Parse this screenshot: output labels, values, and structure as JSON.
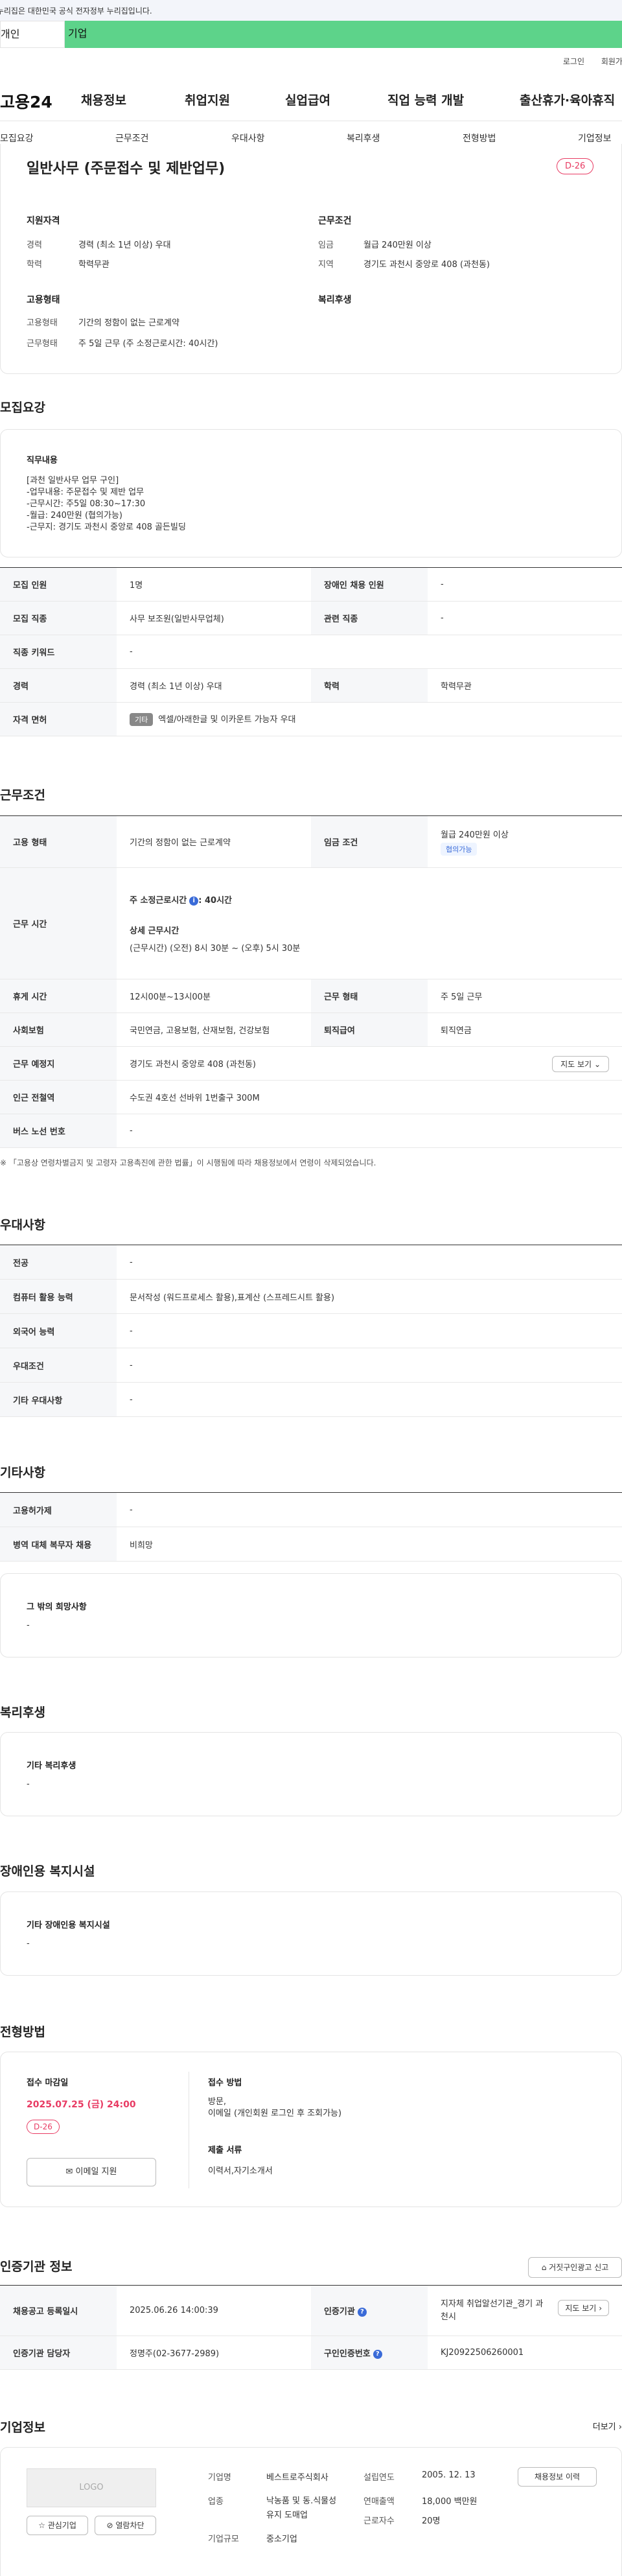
{
  "topbar": {
    "notice": "이 누리집은 대한민국 공식 전자정부 누리집입니다."
  },
  "greenbar": {
    "left": "개인",
    "right": "기업"
  },
  "util": {
    "login": "로그인",
    "join": "회원가입"
  },
  "gnb": {
    "logo": "고용24",
    "menu": [
      "채용정보",
      "취업지원",
      "실업급여",
      "직업 능력 개발",
      "출산휴가·육아휴직"
    ]
  },
  "subnav": [
    "모집요강",
    "근무조건",
    "우대사항",
    "복리후생",
    "전형방법",
    "기업정보"
  ],
  "summary": {
    "title": "일반사무 (주문접수 및 제반업무)",
    "dday": "D-26",
    "qual_title": "지원자격",
    "qual": [
      {
        "k": "경력",
        "v": "경력 (최소 1년 이상) 우대"
      },
      {
        "k": "학력",
        "v": "학력무관"
      }
    ],
    "cond_title": "근무조건",
    "cond": [
      {
        "k": "임금",
        "v": "월급 240만원 이상"
      },
      {
        "k": "지역",
        "v": "경기도 과천시 중앙로 408 (과천동)"
      }
    ],
    "emp_title": "고용형태",
    "emp": [
      {
        "k": "고용형태",
        "v": "기간의 정함이 없는 근로계약"
      },
      {
        "k": "근무형태",
        "v": "주 5일 근무 (주 소정근로시간: 40시간)"
      }
    ],
    "welfare_title": "복리후생"
  },
  "recruit": {
    "title": "모집요강",
    "duty_title": "직무내용",
    "duty_text": "[과천 일반사무 업무 구인]\n-업무내용: 주문접수 및 제반 업무\n-근무시간: 주5일 08:30~17:30\n-월급: 240만원 (협의가능)\n-근무지: 경기도 과천시 중앙로 408 골든빌딩",
    "rows": [
      {
        "k1": "모집 인원",
        "v1": "1명",
        "k2": "장애인 채용 인원",
        "v2": "-"
      },
      {
        "k1": "모집 직종",
        "v1": "사무 보조원(일반사무업체)",
        "k2": "관련 직종",
        "v2": "-"
      },
      {
        "k1": "직종 키워드",
        "v1": "-"
      },
      {
        "k1": "경력",
        "v1": "경력 (최소 1년 이상) 우대",
        "k2": "학력",
        "v2": "학력무관"
      },
      {
        "k1": "자격 면허",
        "tag": "기타",
        "v1": "엑셀/아래한글 및 이카운트 가능자 우대"
      }
    ]
  },
  "work": {
    "title": "근무조건",
    "emp_k": "고용 형태",
    "emp_v": "기간의 정함이 없는 근로계약",
    "wage_k": "임금 조건",
    "wage_v": "월급 240만원 이상",
    "wage_chip": "협의가능",
    "hours_k": "근무 시간",
    "hours_main": "주 소정근로시간",
    "hours_main_v": ": 40시간",
    "hours_detail_title": "상세 근무시간",
    "hours_detail": "(근무시간) (오전) 8시 30분 ~ (오후) 5시 30분",
    "break_k": "휴게 시간",
    "break_v": "12시00분~13시00분",
    "type_k": "근무 형태",
    "type_v": "주 5일 근무",
    "ins_k": "사회보험",
    "ins_v": "국민연금, 고용보험, 산재보험, 건강보험",
    "ret_k": "퇴직급여",
    "ret_v": "퇴직연금",
    "place_k": "근무 예정지",
    "place_v": "경기도 과천시 중앙로 408 (과천동)",
    "map_btn": "지도 보기",
    "subway_k": "인근 전철역",
    "subway_v": "수도권 4호선 선바위 1번출구 300M",
    "bus_k": "버스 노선 번호",
    "bus_v": "-",
    "note": "※ 「고용상 연령차별금지 및 고령자 고용촉진에 관한 법률」이 시행됨에 따라 채용정보에서 연령이 삭제되었습니다."
  },
  "pref": {
    "title": "우대사항",
    "rows": [
      {
        "k": "전공",
        "v": "-"
      },
      {
        "k": "컴퓨터 활용 능력",
        "v": "문서작성 (워드프로세스 활용),표계산 (스프레드시트 활용)"
      },
      {
        "k": "외국어 능력",
        "v": "-"
      },
      {
        "k": "우대조건",
        "v": "-"
      },
      {
        "k": "기타 우대사항",
        "v": "-"
      }
    ]
  },
  "etc": {
    "title": "기타사항",
    "rows": [
      {
        "k": "고용허가제",
        "v": "-"
      },
      {
        "k": "병역 대체 복무자 채용",
        "v": "비희망"
      }
    ],
    "hope_title": "그 밖의 희망사항",
    "hope_v": "-"
  },
  "welfare": {
    "title": "복리후생",
    "box_title": "기타 복리후생",
    "box_v": "-"
  },
  "disab": {
    "title": "장애인용 복지시설",
    "box_title": "기타 장애인용 복지시설",
    "box_v": "-"
  },
  "select": {
    "title": "전형방법",
    "deadline_title": "접수 마감일",
    "deadline": "2025.07.25 (금) 24:00",
    "dday": "D-26",
    "email_btn": "이메일 지원",
    "method_title": "접수 방법",
    "method_v": "방문,\n이메일 (개인회원 로그인 후 조회가능)",
    "docs_title": "제출 서류",
    "docs_v": "이력서,자기소개서"
  },
  "agency": {
    "title": "인증기관 정보",
    "report_btn": "거짓구인광고 신고",
    "reg_k": "채용공고 등록일시",
    "reg_v": "2025.06.26 14:00:39",
    "cert_k": "인증기관",
    "cert_v": "지자체 취업알선기관_경기 과천시",
    "map_btn": "지도 보기",
    "mgr_k": "인증기관 담당자",
    "mgr_v": "정명주(02-3677-2989)",
    "no_k": "구인인증번호",
    "no_v": "KJ20922506260001"
  },
  "company": {
    "title": "기업정보",
    "more": "더보기",
    "logo": "LOGO",
    "fav_btn": "관심기업",
    "block_btn": "열람차단",
    "name_k": "기업명",
    "name_v": "베스트로주식회사",
    "ind_k": "업종",
    "ind_v": "낙농품 및 동.식물성 유지 도매업",
    "size_k": "기업규모",
    "size_v": "중소기업",
    "est_k": "설립연도",
    "est_v": "2005. 12. 13",
    "rev_k": "연매출액",
    "rev_v": "18,000 백만원",
    "emp_k": "근로자수",
    "emp_v": "20명",
    "history_btn": "채용정보 이력"
  }
}
